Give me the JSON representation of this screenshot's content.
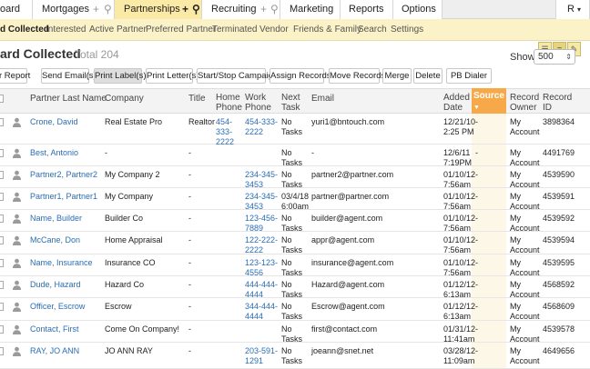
{
  "tabs": {
    "dashboard": "oard",
    "mortgages": "Mortgages",
    "partnerships": "Partnerships",
    "recruiting": "Recruiting",
    "marketing": "Marketing",
    "reports": "Reports",
    "options": "Options",
    "user": "R"
  },
  "subnav": {
    "items": [
      "d Collected",
      "Interested",
      "Active Partner",
      "Preferred Partner",
      "Terminated",
      "Vendor",
      "Friends & Family",
      "Search",
      "Settings"
    ]
  },
  "header": {
    "title": "ard Collected",
    "total": "Total 204",
    "show_label": "Show:",
    "show_value": "500"
  },
  "actions": [
    "r Report",
    "Send Email(s)",
    "Print Label(s)",
    "Print Letter(s)",
    "Start/Stop Campaign",
    "Assign Records",
    "Move Records",
    "Merge",
    "Delete",
    "PB Dialer"
  ],
  "columns": {
    "last_name": "Partner Last Name",
    "company": "Company",
    "title": "Title",
    "home_phone": [
      "Home",
      "Phone"
    ],
    "work_phone": [
      "Work",
      "Phone"
    ],
    "next_task": [
      "Next",
      "Task"
    ],
    "email": "Email",
    "added_date": [
      "Added",
      "Date"
    ],
    "source": "Source",
    "record_owner": [
      "Record",
      "Owner"
    ],
    "record_id": [
      "Record",
      "ID"
    ]
  },
  "rows": [
    {
      "name": "Crone, David",
      "company": "Real Estate Pro",
      "title": "Realtor",
      "home": [
        "454-",
        "333-",
        "2222"
      ],
      "work": [
        "454-333-",
        "2222"
      ],
      "task": [
        "No",
        "Tasks"
      ],
      "email": "yuri1@bntouch.com",
      "date": [
        "12/21/10",
        "2:25 PM"
      ],
      "source": "-",
      "owner": [
        "My",
        "Account"
      ],
      "id": "3898364"
    },
    {
      "name": "Best, Antonio",
      "company": "-",
      "title": "-",
      "home": [],
      "work": [],
      "task": [
        "No",
        "Tasks"
      ],
      "email": "-",
      "date": [
        "12/6/11",
        "7:19PM"
      ],
      "source": "-",
      "owner": [
        "My",
        "Account"
      ],
      "id": "4491769"
    },
    {
      "name": "Partner2, Partner2",
      "company": "My Company 2",
      "title": "-",
      "home": [],
      "work": [
        "234-345-",
        "3453"
      ],
      "task": [
        "No",
        "Tasks"
      ],
      "email": "partner2@partner.com",
      "date": [
        "01/10/12",
        "7:56am"
      ],
      "source": "-",
      "owner": [
        "My",
        "Account"
      ],
      "id": "4539590"
    },
    {
      "name": "Partner1, Partner1",
      "company": "My Company",
      "title": "-",
      "home": [],
      "work": [
        "234-345-",
        "3453"
      ],
      "task": [
        "03/4/18",
        "6:00am"
      ],
      "email": "partner@partner.com",
      "date": [
        "01/10/12",
        "7:56am"
      ],
      "source": "-",
      "owner": [
        "My",
        "Account"
      ],
      "id": "4539591"
    },
    {
      "name": "Name, Builder",
      "company": "Builder Co",
      "title": "-",
      "home": [],
      "work": [
        "123-456-",
        "7889"
      ],
      "task": [
        "No",
        "Tasks"
      ],
      "email": "builder@agent.com",
      "date": [
        "01/10/12",
        "7:56am"
      ],
      "source": "-",
      "owner": [
        "My",
        "Account"
      ],
      "id": "4539592"
    },
    {
      "name": "McCane, Don",
      "company": "Home Appraisal",
      "title": "-",
      "home": [],
      "work": [
        "122-222-",
        "2222"
      ],
      "task": [
        "No",
        "Tasks"
      ],
      "email": "appr@agent.com",
      "date": [
        "01/10/12",
        "7:56am"
      ],
      "source": "-",
      "owner": [
        "My",
        "Account"
      ],
      "id": "4539594"
    },
    {
      "name": "Name, Insurance",
      "company": "Insurance CO",
      "title": "-",
      "home": [],
      "work": [
        "123-123-",
        "4556"
      ],
      "task": [
        "No",
        "Tasks"
      ],
      "email": "insurance@agent.com",
      "date": [
        "01/10/12",
        "7:56am"
      ],
      "source": "-",
      "owner": [
        "My",
        "Account"
      ],
      "id": "4539595"
    },
    {
      "name": "Dude, Hazard",
      "company": "Hazard Co",
      "title": "-",
      "home": [],
      "work": [
        "444-444-",
        "4444"
      ],
      "task": [
        "No",
        "Tasks"
      ],
      "email": "Hazard@agent.com",
      "date": [
        "01/12/12",
        "6:13am"
      ],
      "source": "-",
      "owner": [
        "My",
        "Account"
      ],
      "id": "4568592"
    },
    {
      "name": "Officer, Escrow",
      "company": "Escrow",
      "title": "-",
      "home": [],
      "work": [
        "344-444-",
        "4444"
      ],
      "task": [
        "No",
        "Tasks"
      ],
      "email": "Escrow@agent.com",
      "date": [
        "01/12/12",
        "6:13am"
      ],
      "source": "-",
      "owner": [
        "My",
        "Account"
      ],
      "id": "4568609"
    },
    {
      "name": "Contact, First",
      "company": "Come On Company!",
      "title": "-",
      "home": [],
      "work": [],
      "task": [
        "No",
        "Tasks"
      ],
      "email": "first@contact.com",
      "date": [
        "01/31/12",
        "11:41am"
      ],
      "source": "-",
      "owner": [
        "My",
        "Account"
      ],
      "id": "4539578"
    },
    {
      "name": "RAY, JO ANN",
      "company": "JO ANN RAY",
      "title": "-",
      "home": [],
      "work": [
        "203-591-",
        "1291"
      ],
      "task": [
        "No",
        "Tasks"
      ],
      "email": "joeann@snet.net",
      "date": [
        "03/28/12",
        "11:09am"
      ],
      "source": "-",
      "owner": [
        "My",
        "Account"
      ],
      "id": "4649656"
    }
  ]
}
